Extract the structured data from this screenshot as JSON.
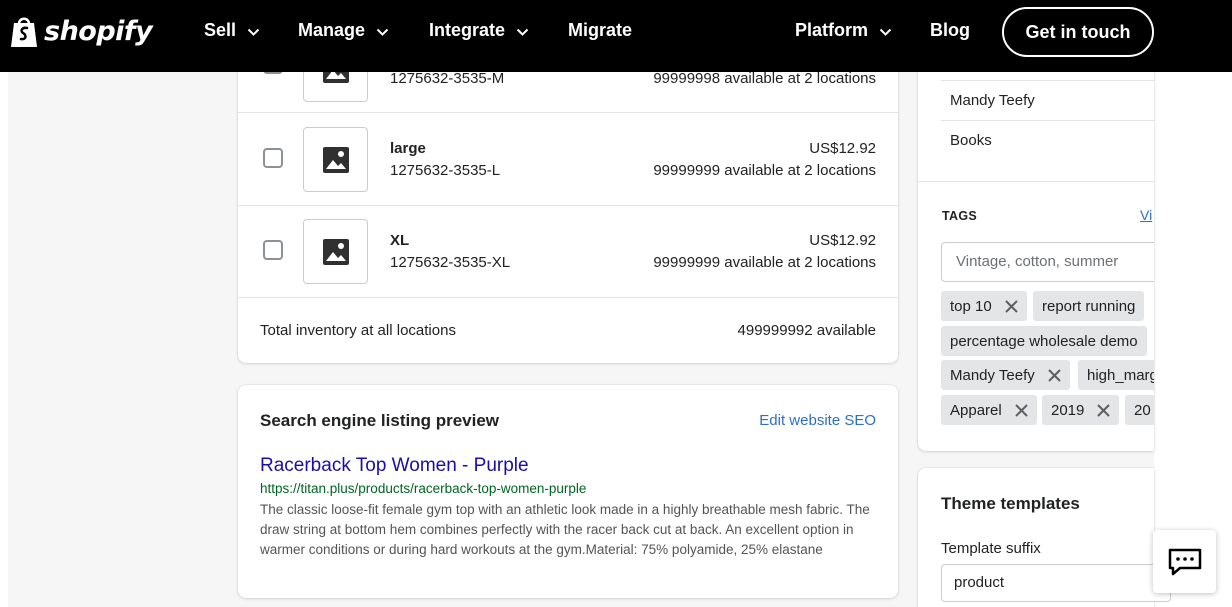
{
  "nav": {
    "brand": "shopify",
    "items": [
      {
        "label": "Sell",
        "dropdown": true
      },
      {
        "label": "Manage",
        "dropdown": true
      },
      {
        "label": "Integrate",
        "dropdown": true
      },
      {
        "label": "Migrate",
        "dropdown": false
      },
      {
        "label": "Platform",
        "dropdown": true
      },
      {
        "label": "Blog",
        "dropdown": false
      }
    ],
    "cta": "Get in touch"
  },
  "variants": {
    "rows": [
      {
        "name": "",
        "sku": "1275632-3535-M",
        "price": "",
        "availability": "99999998 available at 2 locations"
      },
      {
        "name": "large",
        "sku": "1275632-3535-L",
        "price": "US$12.92",
        "availability": "99999999 available at 2 locations"
      },
      {
        "name": "XL",
        "sku": "1275632-3535-XL",
        "price": "US$12.92",
        "availability": "99999999 available at 2 locations"
      }
    ],
    "total_label": "Total inventory at all locations",
    "total_value": "499999992 available"
  },
  "seo": {
    "heading": "Search engine listing preview",
    "edit_link": "Edit website SEO",
    "title": "Racerback Top Women - Purple",
    "url": "https://titan.plus/products/racerback-top-women-purple",
    "description": "The classic loose-fit female gym top with an athletic look made in a highly breathable mesh fabric. The draw string at bottom hem combines perfectly with the racer back cut at back. An excellent option in warmer conditions or during hard workouts at the gym.Material: 75% polyamide, 25% elastane"
  },
  "organization": {
    "vendor": "Mandy Teefy",
    "collection": "Books"
  },
  "tags": {
    "heading": "TAGS",
    "link": "Vi",
    "placeholder": "Vintage, cotton, summer",
    "items": [
      "top 10",
      "report running",
      "percentage wholesale demo",
      "Mandy Teefy",
      "high_marg",
      "Apparel",
      "2019",
      "20"
    ]
  },
  "theme": {
    "heading": "Theme templates",
    "suffix_label": "Template suffix",
    "suffix_value": "product"
  },
  "colors": {
    "nav_bg": "#000000",
    "link": "#2c6ecb",
    "seo_title": "#1a0dab",
    "seo_url": "#006621",
    "page_bg": "#f6f6f7"
  },
  "icons": [
    "shopify-bag-icon",
    "chevron-down-icon",
    "image-placeholder-icon",
    "close-icon",
    "chat-icon"
  ]
}
